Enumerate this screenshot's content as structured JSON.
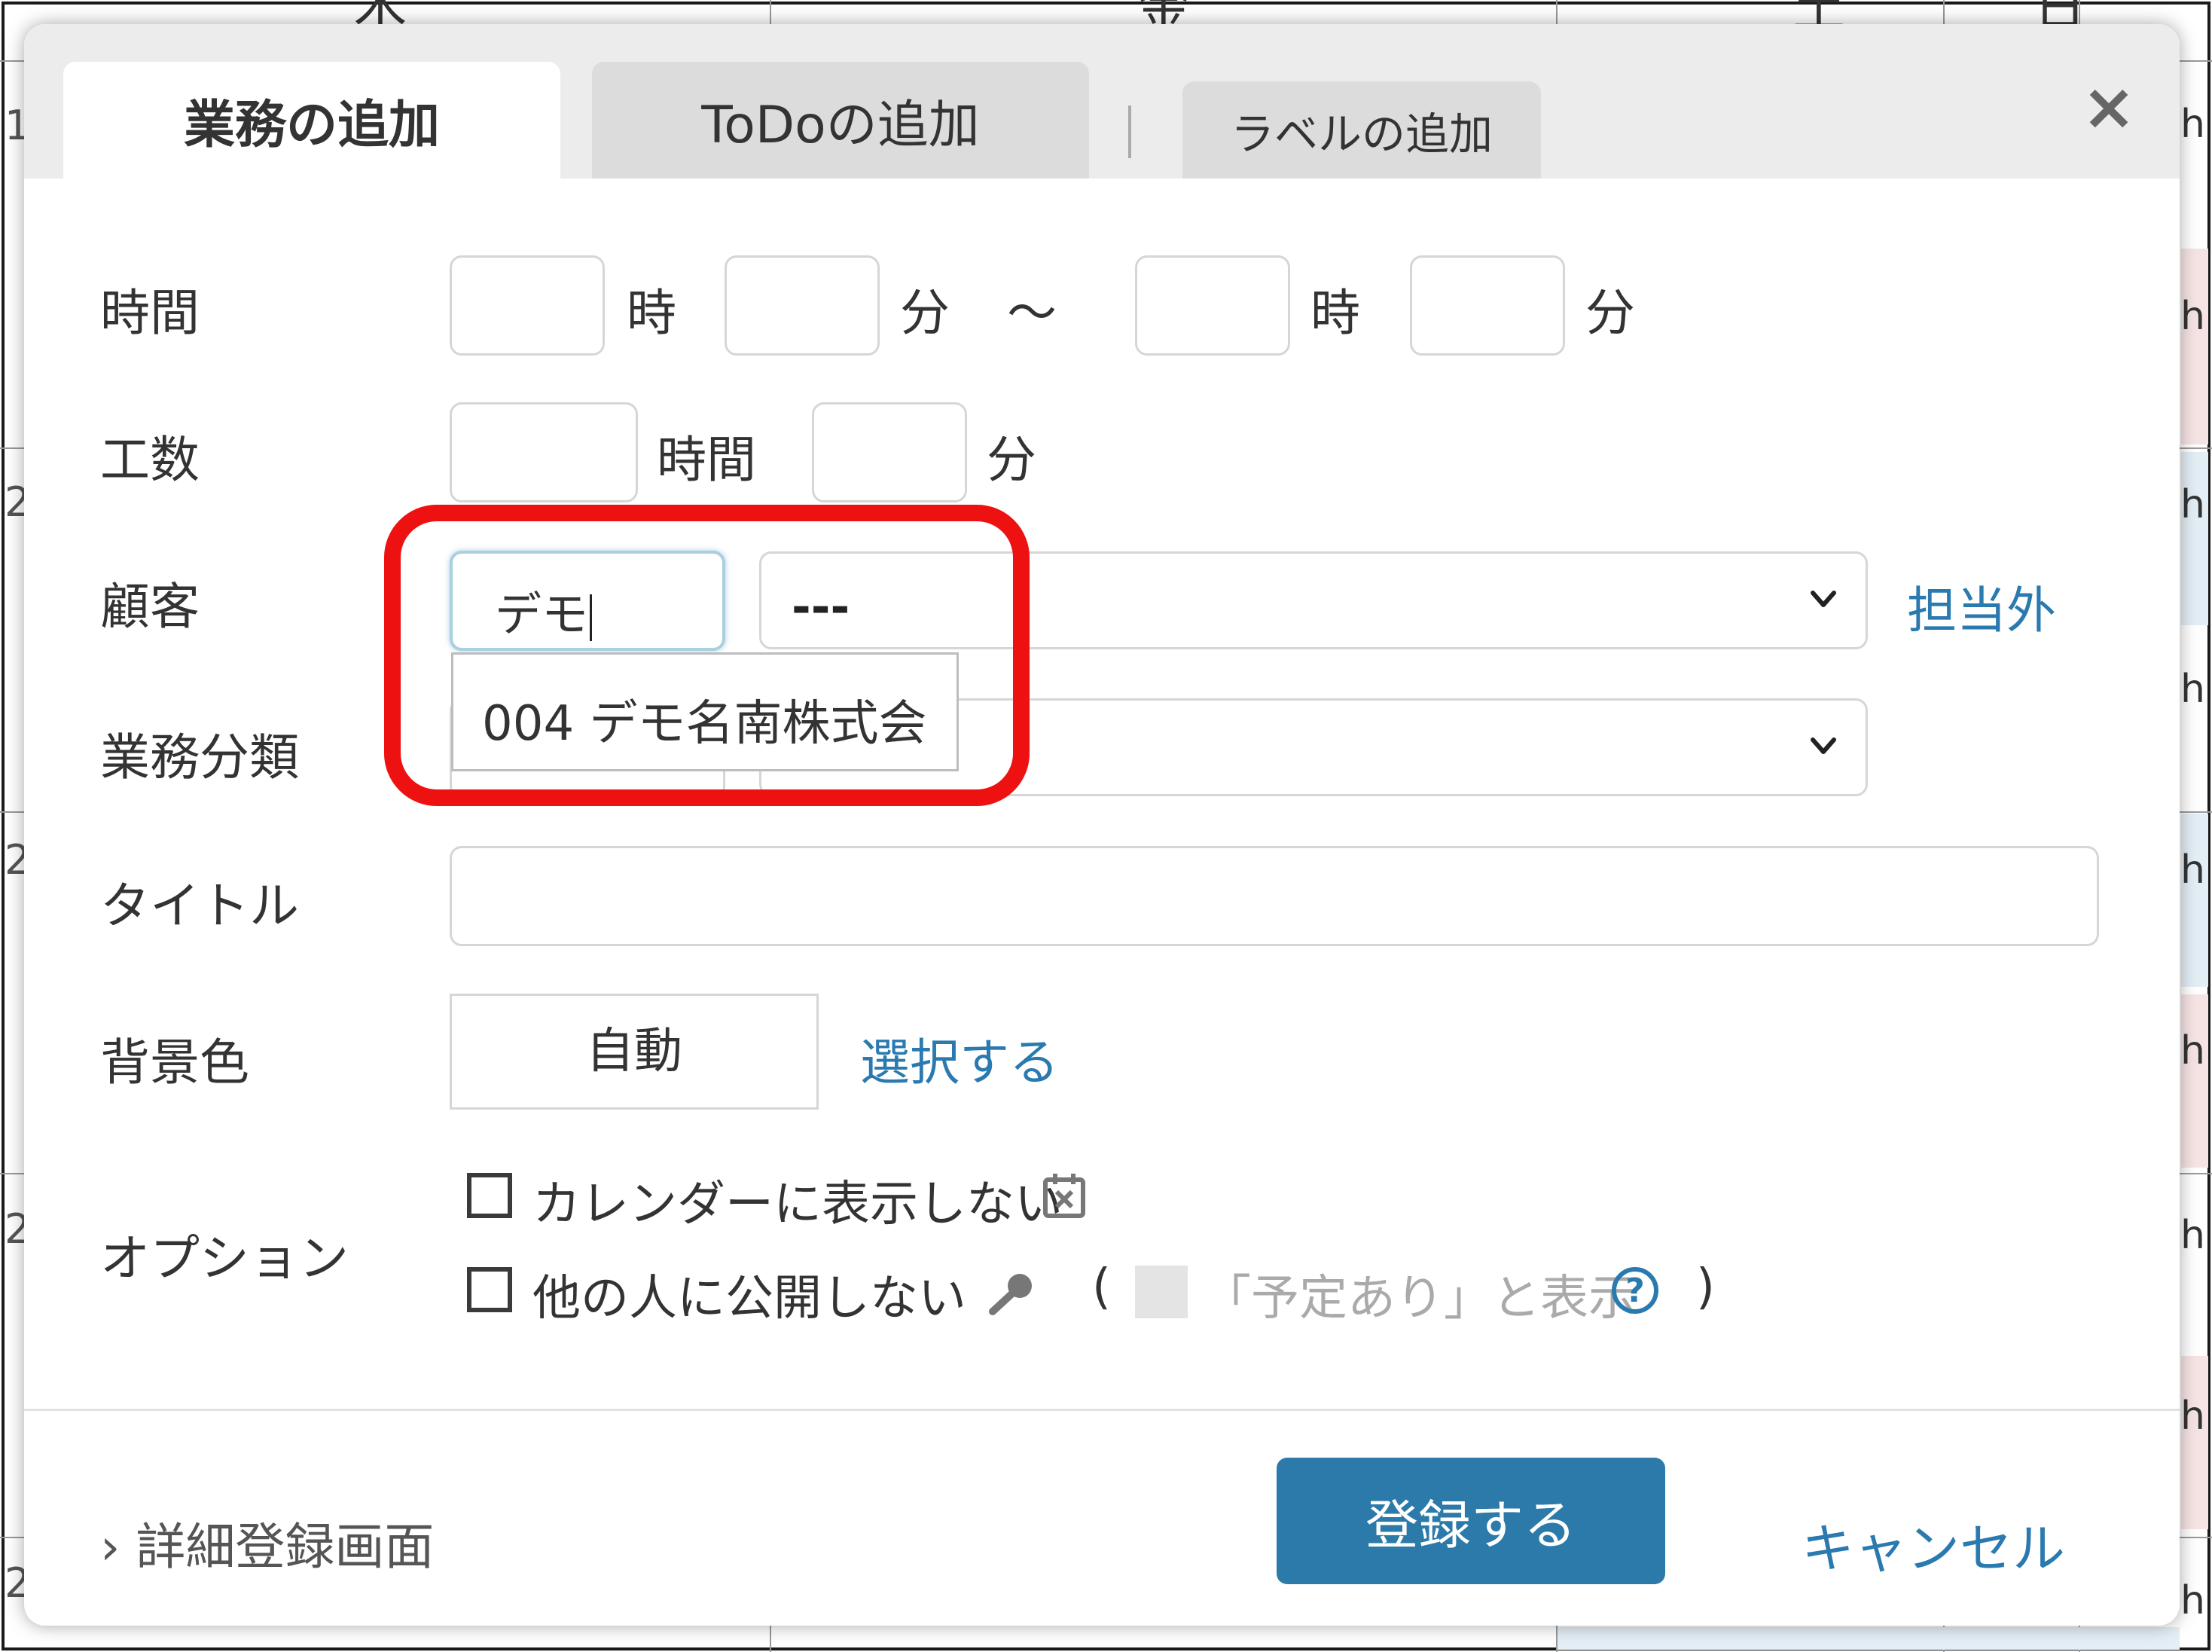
{
  "background": {
    "day_headers": [
      "木",
      "金",
      "土",
      "日"
    ],
    "row_numbers": [
      "1",
      "2",
      "2",
      "2",
      "2"
    ],
    "right_marks": [
      "h",
      "h",
      "h",
      "h",
      "h",
      "h",
      "h",
      "h",
      "h",
      "h"
    ]
  },
  "dialog": {
    "tabs": [
      {
        "label": "業務の追加",
        "active": true
      },
      {
        "label": "ToDoの追加",
        "active": false
      },
      {
        "label": "ラベルの追加",
        "active": false
      }
    ],
    "close_label": "×",
    "time": {
      "label": "時間",
      "hour_unit": "時",
      "minute_unit": "分",
      "tilde": "～",
      "start_hour": "",
      "start_minute": "",
      "end_hour": "",
      "end_minute": ""
    },
    "effort": {
      "label": "工数",
      "hours_unit": "時間",
      "minutes_unit": "分",
      "hours": "",
      "minutes": ""
    },
    "customer": {
      "label": "顧客",
      "search_value": "デモ",
      "select_value": "---",
      "out_of_charge_link": "担当外",
      "suggestion": "004 デモ名南株式会"
    },
    "category": {
      "label": "業務分類",
      "select_value": ""
    },
    "title": {
      "label": "タイトル",
      "value": ""
    },
    "bg_color": {
      "label": "背景色",
      "value": "自動",
      "select_link": "選択する"
    },
    "options": {
      "label": "オプション",
      "hide_calendar": "カレンダーに表示しない",
      "private": "他の人に公開しない",
      "paren_open": "(",
      "show_busy": "「予定あり」と表示",
      "paren_close": ")"
    },
    "footer": {
      "detail_link": "詳細登録画面",
      "chevron": "›",
      "submit": "登録する",
      "cancel": "キャンセル"
    }
  },
  "colors": {
    "accent": "#2c7aa9",
    "link": "#2a7ab0",
    "highlight": "#ee1111"
  }
}
